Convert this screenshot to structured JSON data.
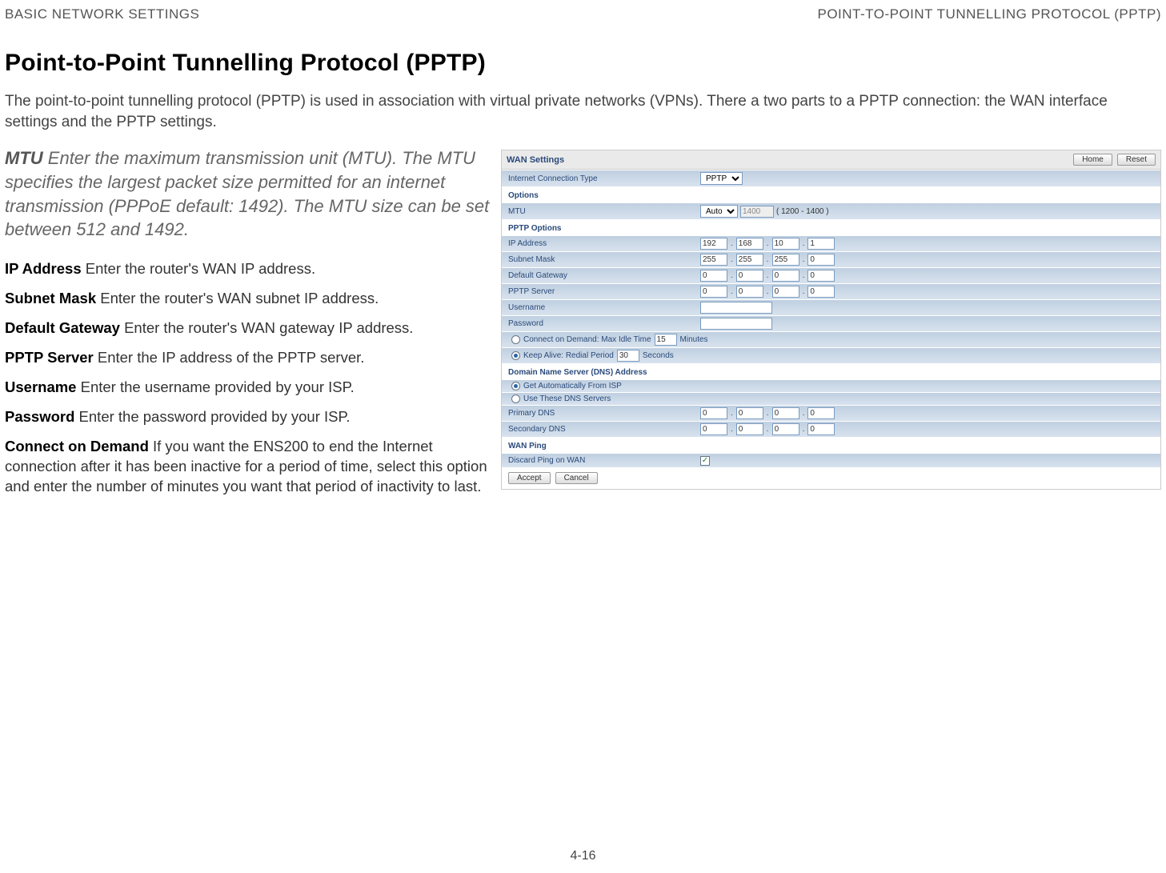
{
  "header": {
    "left": "BASIC NETWORK SETTINGS",
    "right": "POINT-TO-POINT TUNNELLING PROTOCOL (PPTP)"
  },
  "title": "Point-to-Point Tunnelling Protocol (PPTP)",
  "intro": "The point-to-point tunnelling protocol (PPTP) is used in association with virtual private networks (VPNs). There a two parts to a PPTP connection: the WAN interface settings and the PPTP settings.",
  "definitions": {
    "mtu": {
      "label": "MTU",
      "text": "Enter the maximum transmission unit (MTU). The MTU specifies the largest packet size permitted for an internet transmission (PPPoE default: 1492). The MTU size can be set between 512 and 1492."
    },
    "ip_address": {
      "label": "IP Address",
      "text": "Enter the router's WAN IP address."
    },
    "subnet_mask": {
      "label": "Subnet Mask",
      "text": "Enter the router's WAN subnet IP address."
    },
    "default_gateway": {
      "label": "Default Gateway",
      "text": "Enter the router's WAN gateway IP address."
    },
    "pptp_server": {
      "label": "PPTP Server",
      "text": "Enter the IP address of the PPTP server."
    },
    "username": {
      "label": "Username",
      "text": "Enter the username provided by your ISP."
    },
    "password": {
      "label": "Password",
      "text": "Enter the password provided by your ISP."
    },
    "connect_on_demand": {
      "label": "Connect on Demand",
      "text": "If you want the ENS200 to end the Internet connection after it has been inactive for a period of time, select this option and enter the number of minutes you want that period of inactivity to last."
    }
  },
  "screenshot": {
    "title": "WAN Settings",
    "buttons": {
      "home": "Home",
      "reset": "Reset"
    },
    "internet_connection_type": {
      "label": "Internet Connection Type",
      "value": "PPTP"
    },
    "options_title": "Options",
    "mtu": {
      "label": "MTU",
      "mode": "Auto",
      "value": "1400",
      "range": "( 1200 - 1400 )"
    },
    "pptp_options_title": "PPTP Options",
    "ip_address": {
      "label": "IP Address",
      "octets": [
        "192",
        "168",
        "10",
        "1"
      ]
    },
    "subnet_mask": {
      "label": "Subnet Mask",
      "octets": [
        "255",
        "255",
        "255",
        "0"
      ]
    },
    "default_gateway": {
      "label": "Default Gateway",
      "octets": [
        "0",
        "0",
        "0",
        "0"
      ]
    },
    "pptp_server": {
      "label": "PPTP Server",
      "octets": [
        "0",
        "0",
        "0",
        "0"
      ]
    },
    "username": {
      "label": "Username",
      "value": ""
    },
    "password": {
      "label": "Password",
      "value": ""
    },
    "connect_on_demand": {
      "label": "Connect on Demand: Max Idle Time",
      "value": "15",
      "unit": "Minutes"
    },
    "keep_alive": {
      "label": "Keep Alive: Redial Period",
      "value": "30",
      "unit": "Seconds"
    },
    "dns_title": "Domain Name Server (DNS) Address",
    "dns_auto": "Get Automatically From ISP",
    "dns_manual": "Use These DNS Servers",
    "primary_dns": {
      "label": "Primary DNS",
      "octets": [
        "0",
        "0",
        "0",
        "0"
      ]
    },
    "secondary_dns": {
      "label": "Secondary DNS",
      "octets": [
        "0",
        "0",
        "0",
        "0"
      ]
    },
    "wan_ping_title": "WAN Ping",
    "discard_ping": {
      "label": "Discard Ping on WAN"
    },
    "footer": {
      "accept": "Accept",
      "cancel": "Cancel"
    }
  },
  "page_number": "4-16"
}
